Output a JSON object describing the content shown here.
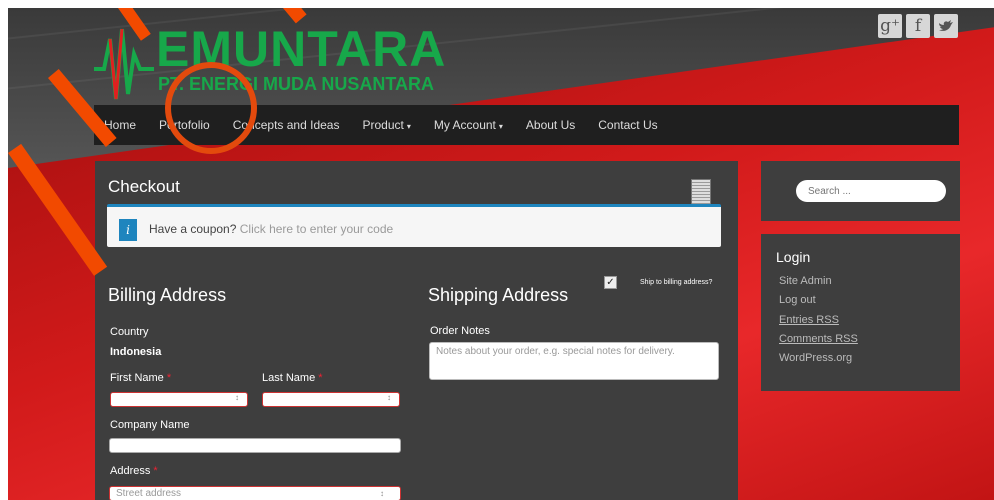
{
  "brand": {
    "logo_name": "EMUNTARA",
    "logo_tagline": "PT. ENERGI MUDA NUSANTARA",
    "green": "#17a84a"
  },
  "social": {
    "google": "g+",
    "facebook": "f",
    "twitter": "t"
  },
  "nav": {
    "home": "Home",
    "portfolio": "Portofolio",
    "concepts": "Concepts and Ideas",
    "product": "Product",
    "account": "My Account",
    "about": "About Us",
    "contact": "Contact Us",
    "caret": "▾"
  },
  "checkout": {
    "title": "Checkout",
    "coupon_prefix": "Have a coupon?",
    "coupon_link": "Click here to enter your code",
    "billing_title": "Billing Address",
    "shipping_title": "Shipping Address",
    "ship_to_billing": "Ship to billing address?",
    "ship_to_billing_checked": true
  },
  "billing": {
    "country_label": "Country",
    "country_value": "Indonesia",
    "first_name_label": "First Name",
    "last_name_label": "Last Name",
    "company_label": "Company Name",
    "address_label": "Address",
    "street_placeholder": "Street address",
    "required_mark": "*"
  },
  "shipping": {
    "order_notes_label": "Order Notes",
    "order_notes_placeholder": "Notes about your order, e.g. special notes for delivery."
  },
  "sidebar": {
    "search_placeholder": "Search ...",
    "login_title": "Login",
    "links": [
      "Site Admin",
      "Log out",
      "Entries RSS",
      "Comments RSS",
      "WordPress.org"
    ]
  },
  "colors": {
    "accent_blue": "#1e85be",
    "background_red": "#d11a1a",
    "panel": "#3e3e3e",
    "nav": "#1f1f1f"
  }
}
